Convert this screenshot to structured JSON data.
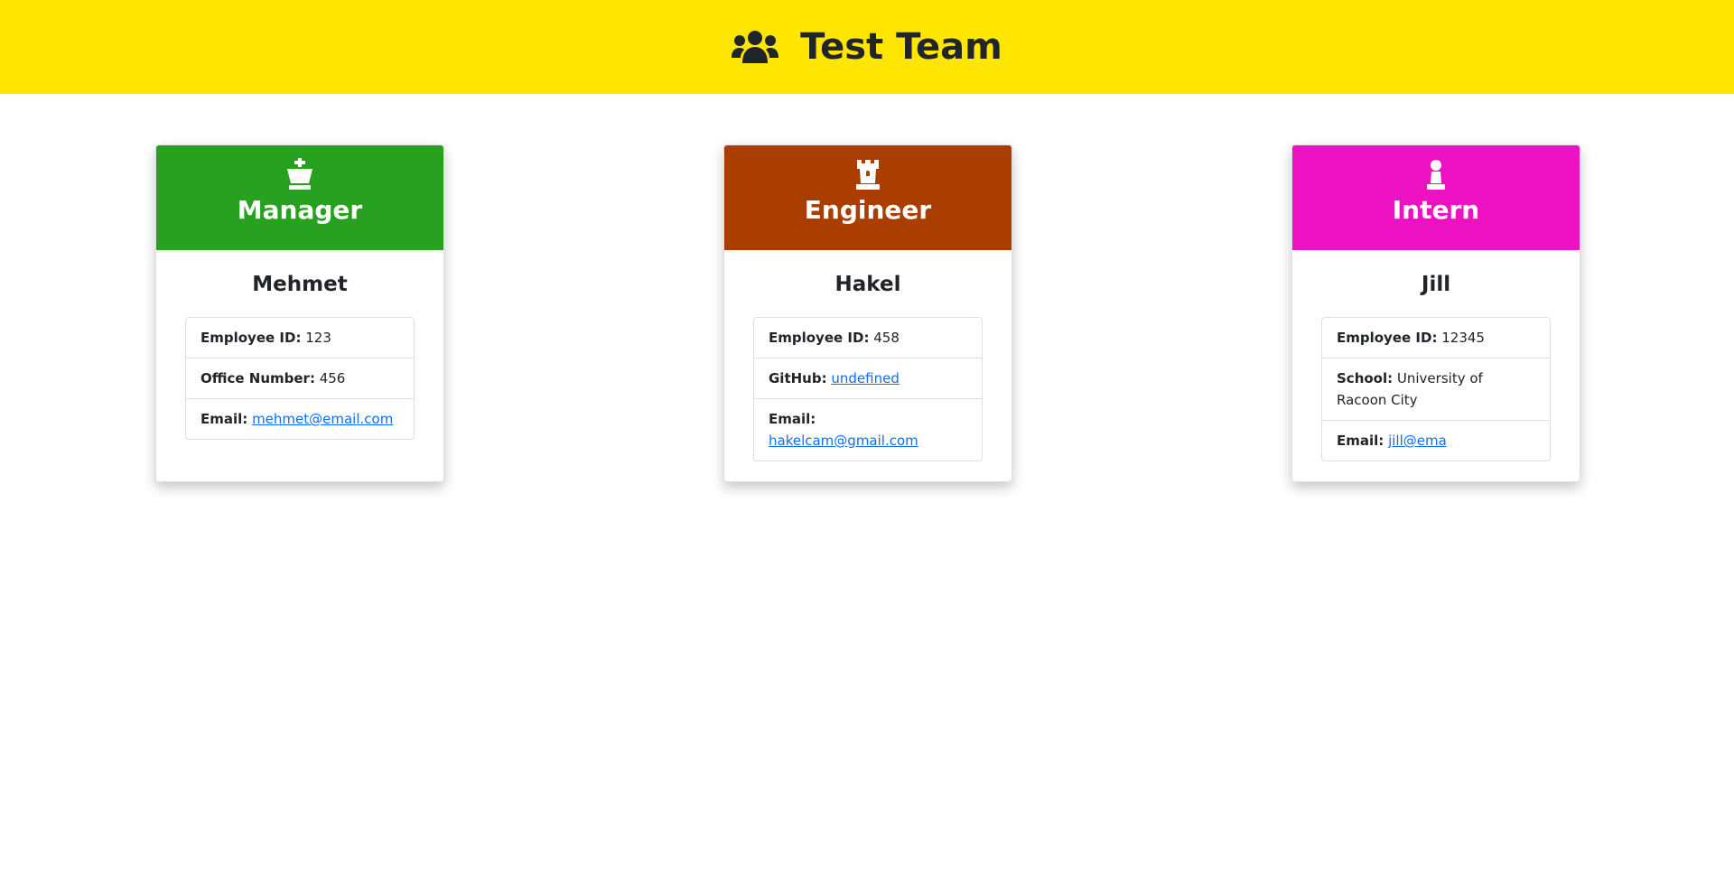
{
  "header": {
    "title": "Test Team",
    "icon": "users-icon",
    "bg_color": "#ffe600"
  },
  "cards": [
    {
      "role": "Manager",
      "role_icon": "chess-king-icon",
      "header_color": "#28a121",
      "name": "Mehmet",
      "fields": [
        {
          "label": "Employee ID:",
          "value": "123"
        },
        {
          "label": "Office Number:",
          "value": "456"
        },
        {
          "label": "Email:",
          "value": "mehmet@email.com"
        }
      ]
    },
    {
      "role": "Engineer",
      "role_icon": "chess-rook-icon",
      "header_color": "#a93e00",
      "name": "Hakel",
      "fields": [
        {
          "label": "Employee ID:",
          "value": "458"
        },
        {
          "label": "GitHub:",
          "value": "undefined"
        },
        {
          "label": "Email:",
          "value": "hakelcam@gmail.com"
        }
      ]
    },
    {
      "role": "Intern",
      "role_icon": "chess-pawn-icon",
      "header_color": "#ec12c2",
      "name": "Jill",
      "fields": [
        {
          "label": "Employee ID:",
          "value": "12345"
        },
        {
          "label": "School:",
          "value": "University of Racoon City"
        },
        {
          "label": "Email:",
          "value": "jill@ema"
        }
      ]
    }
  ]
}
